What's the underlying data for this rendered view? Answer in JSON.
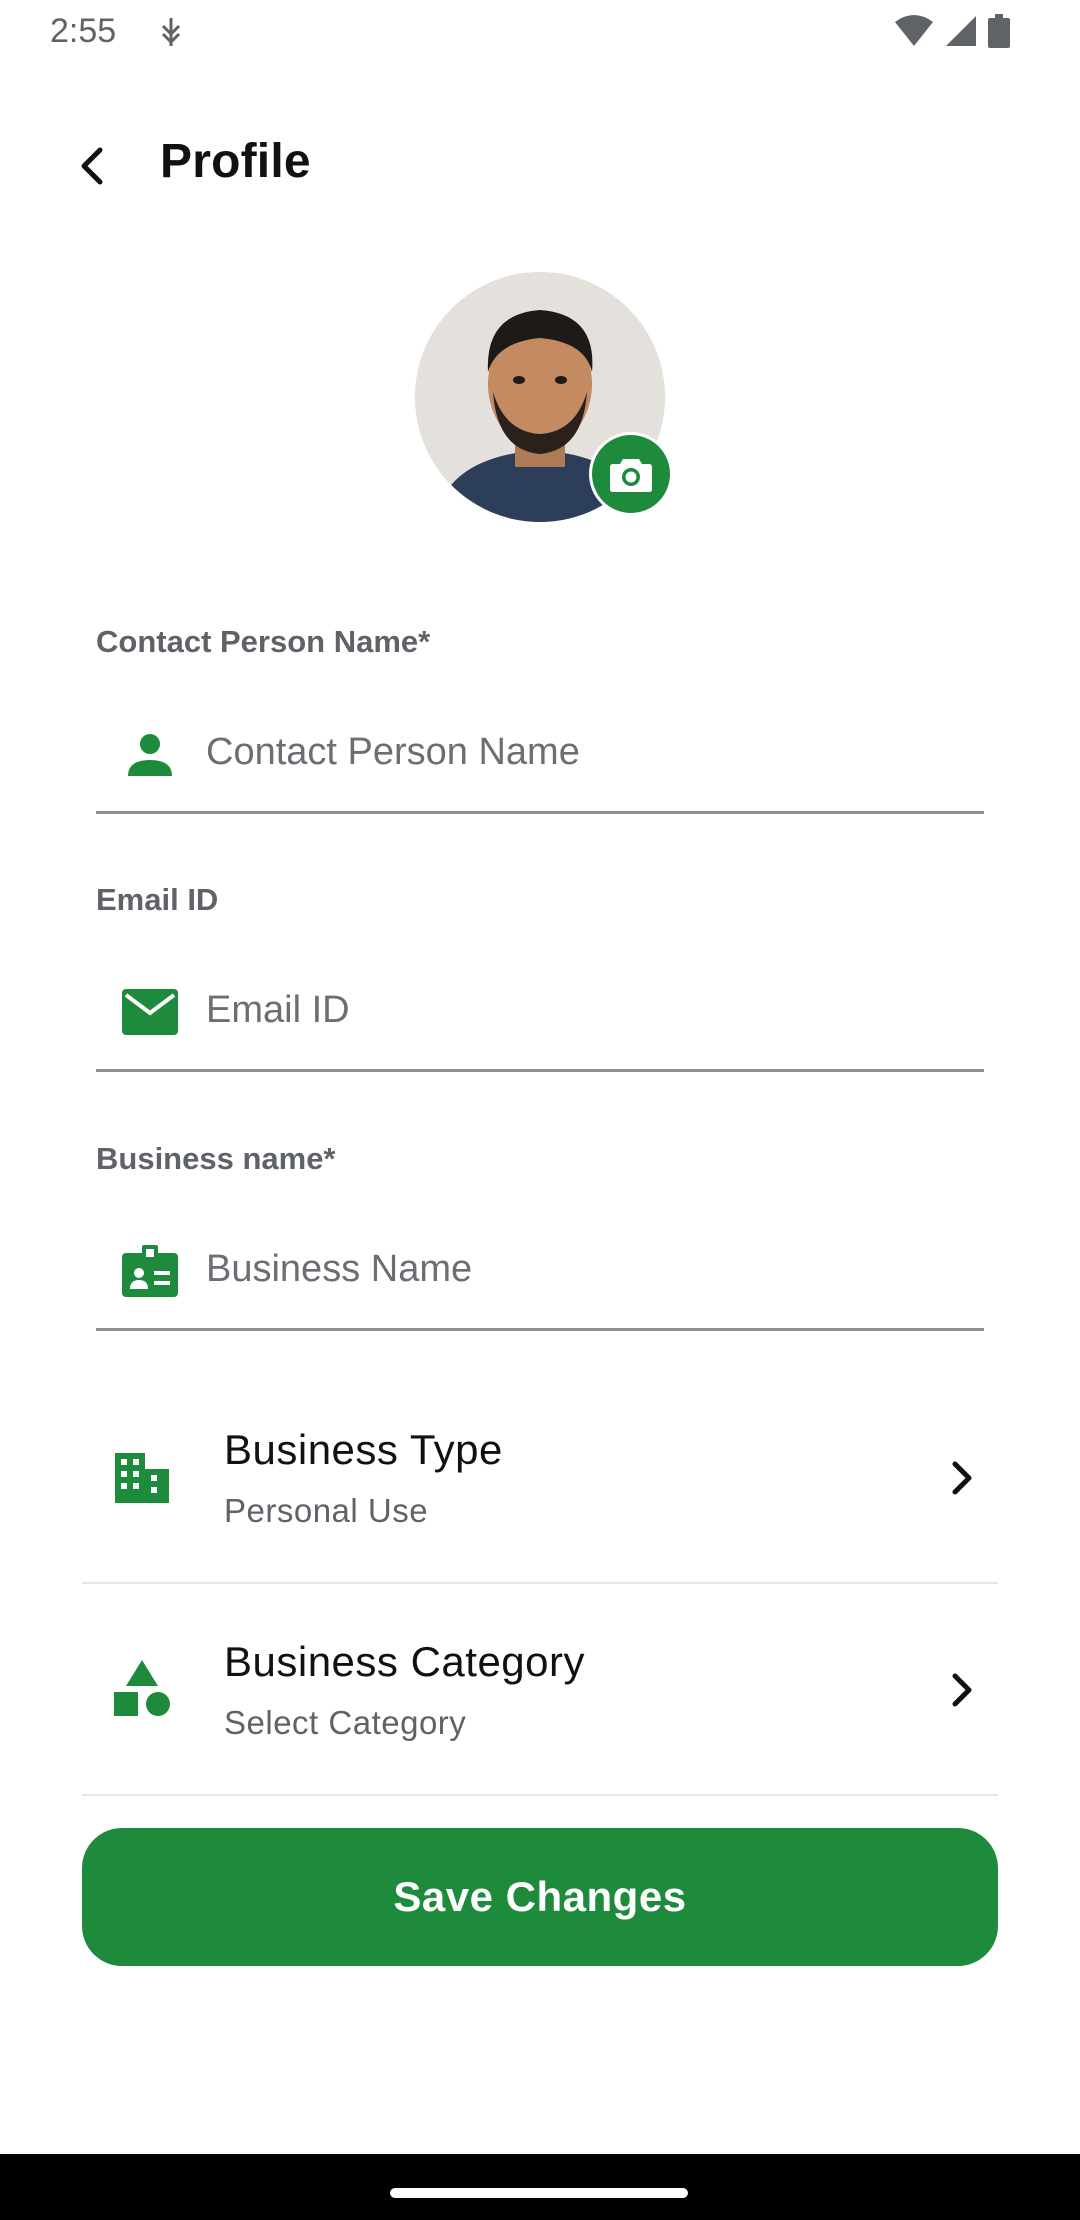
{
  "status_bar": {
    "time": "2:55",
    "icons": [
      "usb-debug-icon",
      "wifi-icon",
      "signal-icon",
      "battery-icon"
    ]
  },
  "header": {
    "title": "Profile",
    "back_icon": "arrow-back-icon"
  },
  "avatar": {
    "camera_icon": "camera-icon"
  },
  "fields": [
    {
      "label": "Contact Person Name*",
      "placeholder": "Contact Person Name",
      "value": "",
      "icon": "person-icon"
    },
    {
      "label": "Email ID",
      "placeholder": "Email ID",
      "value": "",
      "icon": "mail-icon"
    },
    {
      "label": "Business name*",
      "placeholder": "Business Name",
      "value": "",
      "icon": "badge-icon"
    }
  ],
  "list_items": [
    {
      "title": "Business Type",
      "subtitle": "Personal Use",
      "icon": "building-icon"
    },
    {
      "title": "Business Category",
      "subtitle": "Select Category",
      "icon": "category-shapes-icon"
    }
  ],
  "actions": {
    "save_label": "Save Changes"
  },
  "colors": {
    "accent": "#1e8a3c",
    "label_gray": "#5f6368",
    "underline": "#8f8f8f"
  }
}
